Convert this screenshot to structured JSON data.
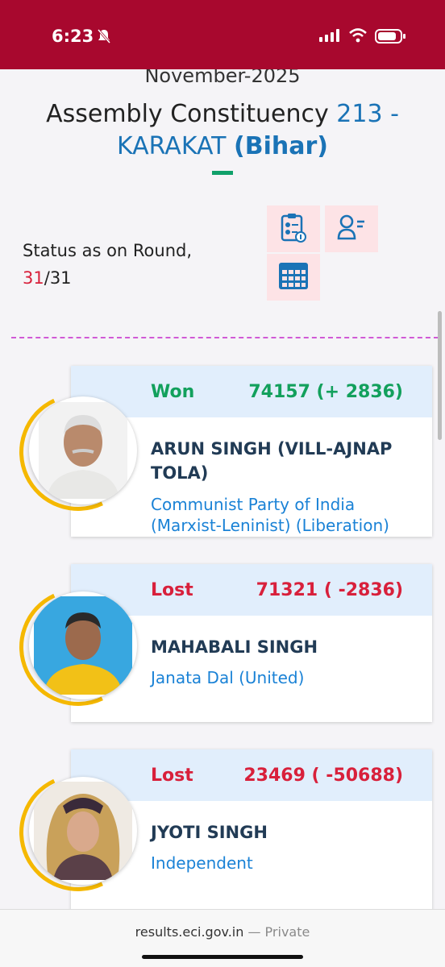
{
  "status_bar": {
    "time": "6:23"
  },
  "header": {
    "election_label": "November-2025",
    "ac_prefix": "Assembly Constituency ",
    "ac_number": "213 -",
    "ac_name": "KARAKAT ",
    "ac_state": "(Bihar)"
  },
  "status": {
    "label": "Status as on Round,",
    "round_current": "31",
    "round_separator": "/",
    "round_total": "31"
  },
  "icons": {
    "report": "clipboard-report-icon",
    "user_list": "user-list-icon",
    "calendar": "calendar-icon"
  },
  "candidates": [
    {
      "result": "Won",
      "votes": "74157 (+ 2836)",
      "name": "ARUN SINGH (VILL-AJNAP TOLA)",
      "party": "Communist Party of India (Marxist-Leninist) (Liberation)"
    },
    {
      "result": "Lost",
      "votes": "71321 ( -2836)",
      "name": "MAHABALI SINGH",
      "party": "Janata Dal (United)"
    },
    {
      "result": "Lost",
      "votes": "23469 ( -50688)",
      "name": "JYOTI SINGH",
      "party": "Independent"
    }
  ],
  "url_bar": {
    "domain": "results.eci.gov.in",
    "separator": " — ",
    "mode": "Private"
  },
  "colors": {
    "status_bar": "#a8082e",
    "won": "#12a05c",
    "lost": "#d8203b",
    "accent_blue": "#1a73b6"
  }
}
